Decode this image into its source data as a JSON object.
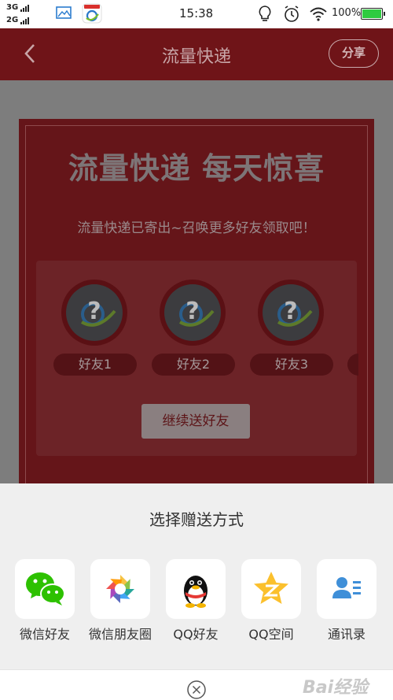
{
  "status_bar": {
    "signal_1": "3G",
    "signal_2": "2G",
    "time": "15:38",
    "battery": "100%",
    "icons": [
      "gallery-icon",
      "app-notification-icon",
      "bulb-icon",
      "alarm-icon",
      "wifi-icon"
    ]
  },
  "navbar": {
    "title": "流量快递",
    "share": "分享"
  },
  "card": {
    "headline": "流量快递 每天惊喜",
    "subtitle": "流量快递已寄出~召唤更多好友领取吧！",
    "friends": [
      {
        "label": "好友1"
      },
      {
        "label": "好友2"
      },
      {
        "label": "好友3"
      }
    ],
    "continue_label": "继续送好友"
  },
  "sheet": {
    "title": "选择赠送方式",
    "options": [
      {
        "label": "微信好友",
        "icon": "wechat-icon"
      },
      {
        "label": "微信朋友圈",
        "icon": "wechat-moments-icon"
      },
      {
        "label": "QQ好友",
        "icon": "qq-icon"
      },
      {
        "label": "QQ空间",
        "icon": "qzone-icon"
      },
      {
        "label": "通讯录",
        "icon": "contacts-icon"
      }
    ]
  },
  "colors": {
    "accent_red": "#c8202a",
    "sheet_bg": "#efefef",
    "battery_green": "#2ecc40"
  }
}
